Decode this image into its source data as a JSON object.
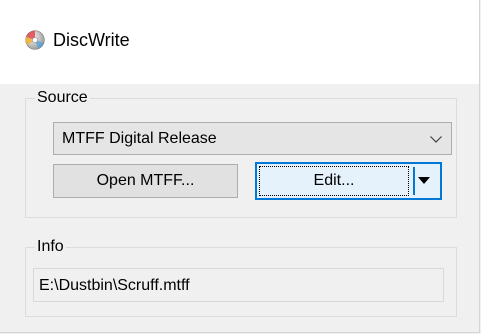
{
  "window": {
    "title": "DiscWrite",
    "icon": "disc-icon"
  },
  "source": {
    "label": "Source",
    "selected": "MTFF Digital Release",
    "open_button": "Open MTFF...",
    "edit_button": "Edit..."
  },
  "info": {
    "label": "Info",
    "path": "E:\\Dustbin\\Scruff.mtff"
  },
  "colors": {
    "accent": "#0078d7",
    "window_bg": "#f0f0f0",
    "titlebar_bg": "#ffffff"
  }
}
